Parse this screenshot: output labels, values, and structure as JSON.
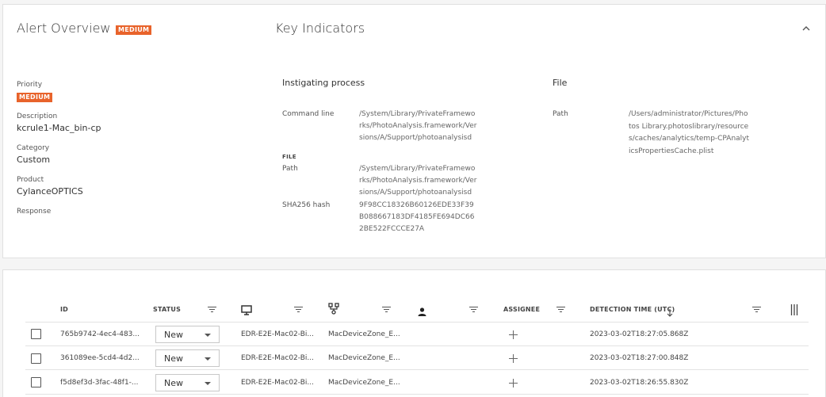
{
  "overview": {
    "title": "Alert Overview",
    "badge": "MEDIUM",
    "priority_label": "Priority",
    "priority_value": "MEDIUM",
    "description_label": "Description",
    "description_value": "kcrule1-Mac_bin-cp",
    "category_label": "Category",
    "category_value": "Custom",
    "product_label": "Product",
    "product_value": "CylanceOPTICS",
    "response_label": "Response"
  },
  "indicators": {
    "title": "Key Indicators",
    "collapse_icon": "chevron-up-icon",
    "process": {
      "title": "Instigating process",
      "command_line_label": "Command line",
      "command_line_value": "/System/Library/PrivateFrameworks/PhotoAnalysis.framework/Versions/A/Support/photoanalysisd",
      "file_section": "FILE",
      "path_label": "Path",
      "path_value": "/System/Library/PrivateFrameworks/PhotoAnalysis.framework/Versions/A/Support/photoanalysisd",
      "sha_label": "SHA256 hash",
      "sha_value": "9F98CC18326B60126EDE33F39B088667183DF4185FE694DC662BE522FCCCE27A"
    },
    "file": {
      "title": "File",
      "path_label": "Path",
      "path_value": "/Users/administrator/Pictures/Photos Library.photoslibrary/resources/caches/analytics/temp-CPAnalyticsPropertiesCache.plist"
    }
  },
  "table": {
    "columns": {
      "id": "ID",
      "status": "STATUS",
      "device_icon": "monitor-icon",
      "zone_icon": "device-zone-icon",
      "user_icon": "user-icon",
      "assignee": "ASSIGNEE",
      "detection_time": "DETECTION TIME (UTC)",
      "sort_icon": "arrow-down-icon",
      "columns_icon": "column-settings-icon"
    },
    "rows": [
      {
        "id": "765b9742-4ec4-483...",
        "status": "New",
        "device": "EDR-E2E-Mac02-Bi...",
        "zone": "MacDeviceZone_E...",
        "user": "",
        "time": "2023-03-02T18:27:05.868Z"
      },
      {
        "id": "361089ee-5cd4-4d2...",
        "status": "New",
        "device": "EDR-E2E-Mac02-Bi...",
        "zone": "MacDeviceZone_E...",
        "user": "",
        "time": "2023-03-02T18:27:00.848Z"
      },
      {
        "id": "f5d8ef3d-3fac-48f1-...",
        "status": "New",
        "device": "EDR-E2E-Mac02-Bi...",
        "zone": "MacDeviceZone_E...",
        "user": "",
        "time": "2023-03-02T18:26:55.830Z"
      }
    ]
  }
}
